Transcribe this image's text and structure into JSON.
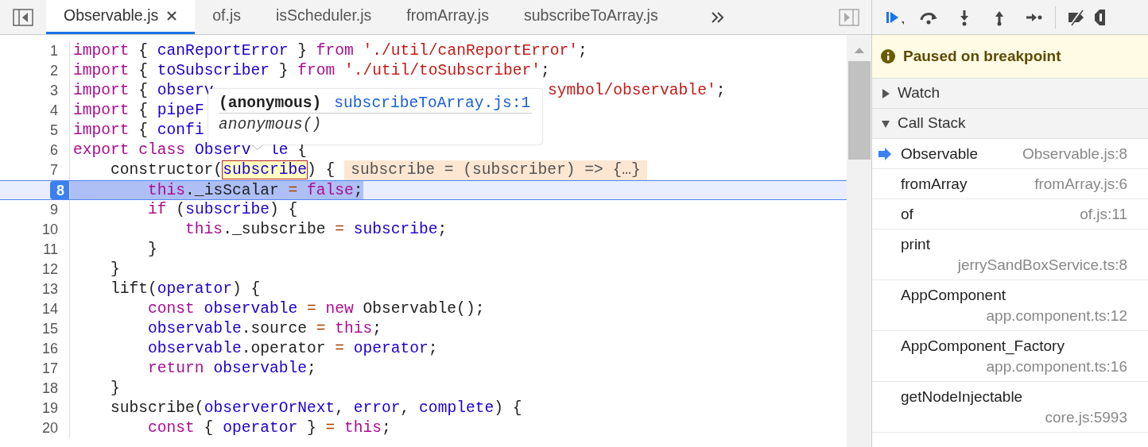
{
  "tabs": [
    {
      "label": "Observable.js",
      "selected": true,
      "closable": true
    },
    {
      "label": "of.js",
      "selected": false,
      "closable": false
    },
    {
      "label": "isScheduler.js",
      "selected": false,
      "closable": false
    },
    {
      "label": "fromArray.js",
      "selected": false,
      "closable": false
    },
    {
      "label": "subscribeToArray.js",
      "selected": false,
      "closable": false
    }
  ],
  "code": {
    "lines": [
      {
        "number": "1",
        "current": false,
        "tokens": [
          {
            "kind": "keyword",
            "text": "import"
          },
          {
            "kind": "plain",
            "text": " { "
          },
          {
            "kind": "variable",
            "text": "canReportError"
          },
          {
            "kind": "plain",
            "text": " } "
          },
          {
            "kind": "keyword",
            "text": "from"
          },
          {
            "kind": "string",
            "text": " './util/canReportError'"
          },
          {
            "kind": "plain",
            "text": ";"
          }
        ]
      },
      {
        "number": "2",
        "current": false,
        "tokens": [
          {
            "kind": "keyword",
            "text": "import"
          },
          {
            "kind": "plain",
            "text": " { "
          },
          {
            "kind": "variable",
            "text": "toSubscriber"
          },
          {
            "kind": "plain",
            "text": " } "
          },
          {
            "kind": "keyword",
            "text": "from"
          },
          {
            "kind": "string",
            "text": " './util/toSubscriber'"
          },
          {
            "kind": "plain",
            "text": ";"
          }
        ]
      },
      {
        "number": "3",
        "current": false,
        "tokens": [
          {
            "kind": "keyword",
            "text": "import"
          },
          {
            "kind": "plain",
            "text": " { "
          },
          {
            "kind": "variable",
            "text": "observ"
          }
        ],
        "tail": {
          "kind": "after_popover",
          "tokens": [
            {
              "kind": "string",
              "text": "symbol/observable'"
            },
            {
              "kind": "plain",
              "text": ";"
            }
          ]
        }
      },
      {
        "number": "4",
        "current": false,
        "tokens": [
          {
            "kind": "keyword",
            "text": "import"
          },
          {
            "kind": "plain",
            "text": " { "
          },
          {
            "kind": "variable",
            "text": "pipeF"
          }
        ]
      },
      {
        "number": "5",
        "current": false,
        "tokens": [
          {
            "kind": "keyword",
            "text": "import"
          },
          {
            "kind": "plain",
            "text": " { "
          },
          {
            "kind": "variable",
            "text": "confi"
          }
        ]
      },
      {
        "number": "6",
        "current": false,
        "tokens": [
          {
            "kind": "keyword",
            "text": "export"
          },
          {
            "kind": "keyword",
            "text": " class"
          },
          {
            "kind": "variable",
            "text": " Observ"
          }
        ],
        "tail": {
          "kind": "after_arrow",
          "tokens": [
            {
              "kind": "variable",
              "text": "le"
            },
            {
              "kind": "plain",
              "text": " {"
            }
          ]
        }
      },
      {
        "number": "7",
        "current": false,
        "tokens": [
          {
            "kind": "plain",
            "text": "    constructor("
          },
          {
            "kind": "hovered",
            "text": "subscribe"
          },
          {
            "kind": "plain",
            "text": ") {"
          }
        ],
        "inline_value": "subscribe = (subscriber) => {…}"
      },
      {
        "number": "8",
        "current": true,
        "tokens": [
          {
            "kind": "keyword",
            "text": "        this"
          },
          {
            "kind": "plain",
            "text": "._isScalar "
          },
          {
            "kind": "operator",
            "text": "="
          },
          {
            "kind": "keyword",
            "text": " false"
          },
          {
            "kind": "plain",
            "text": ";"
          }
        ]
      },
      {
        "number": "9",
        "current": false,
        "tokens": [
          {
            "kind": "keyword",
            "text": "        if"
          },
          {
            "kind": "plain",
            "text": " ("
          },
          {
            "kind": "variable",
            "text": "subscribe"
          },
          {
            "kind": "plain",
            "text": ") {"
          }
        ]
      },
      {
        "number": "10",
        "current": false,
        "tokens": [
          {
            "kind": "keyword",
            "text": "            this"
          },
          {
            "kind": "plain",
            "text": "._subscribe "
          },
          {
            "kind": "operator",
            "text": "="
          },
          {
            "kind": "variable",
            "text": " subscribe"
          },
          {
            "kind": "plain",
            "text": ";"
          }
        ]
      },
      {
        "number": "11",
        "current": false,
        "tokens": [
          {
            "kind": "plain",
            "text": "        }"
          }
        ]
      },
      {
        "number": "12",
        "current": false,
        "tokens": [
          {
            "kind": "plain",
            "text": "    }"
          }
        ]
      },
      {
        "number": "13",
        "current": false,
        "tokens": [
          {
            "kind": "plain",
            "text": "    lift("
          },
          {
            "kind": "variable",
            "text": "operator"
          },
          {
            "kind": "plain",
            "text": ") {"
          }
        ]
      },
      {
        "number": "14",
        "current": false,
        "tokens": [
          {
            "kind": "keyword",
            "text": "        const"
          },
          {
            "kind": "variable",
            "text": " observable"
          },
          {
            "kind": "operator",
            "text": " ="
          },
          {
            "kind": "keyword",
            "text": " new"
          },
          {
            "kind": "plain",
            "text": " Observable();"
          }
        ]
      },
      {
        "number": "15",
        "current": false,
        "tokens": [
          {
            "kind": "variable",
            "text": "        observable"
          },
          {
            "kind": "plain",
            "text": ".source "
          },
          {
            "kind": "operator",
            "text": "="
          },
          {
            "kind": "keyword",
            "text": " this"
          },
          {
            "kind": "plain",
            "text": ";"
          }
        ]
      },
      {
        "number": "16",
        "current": false,
        "tokens": [
          {
            "kind": "variable",
            "text": "        observable"
          },
          {
            "kind": "plain",
            "text": ".operator "
          },
          {
            "kind": "operator",
            "text": "="
          },
          {
            "kind": "variable",
            "text": " operator"
          },
          {
            "kind": "plain",
            "text": ";"
          }
        ]
      },
      {
        "number": "17",
        "current": false,
        "tokens": [
          {
            "kind": "keyword",
            "text": "        return"
          },
          {
            "kind": "variable",
            "text": " observable"
          },
          {
            "kind": "plain",
            "text": ";"
          }
        ]
      },
      {
        "number": "18",
        "current": false,
        "tokens": [
          {
            "kind": "plain",
            "text": "    }"
          }
        ]
      },
      {
        "number": "19",
        "current": false,
        "tokens": [
          {
            "kind": "plain",
            "text": "    subscribe("
          },
          {
            "kind": "variable",
            "text": "observerOrNext"
          },
          {
            "kind": "plain",
            "text": ", "
          },
          {
            "kind": "variable",
            "text": "error"
          },
          {
            "kind": "plain",
            "text": ", "
          },
          {
            "kind": "variable",
            "text": "complete"
          },
          {
            "kind": "plain",
            "text": ") {"
          }
        ]
      },
      {
        "number": "20",
        "current": false,
        "tokens": [
          {
            "kind": "keyword",
            "text": "        const"
          },
          {
            "kind": "plain",
            "text": " { "
          },
          {
            "kind": "variable",
            "text": "operator"
          },
          {
            "kind": "plain",
            "text": " } "
          },
          {
            "kind": "operator",
            "text": "="
          },
          {
            "kind": "keyword",
            "text": " this"
          },
          {
            "kind": "plain",
            "text": ";"
          }
        ]
      }
    ]
  },
  "tooltip": {
    "title": "(anonymous)",
    "link": "subscribeToArray.js:1",
    "body": "anonymous()"
  },
  "banner": {
    "text": "Paused on breakpoint"
  },
  "sections": [
    {
      "title": "Watch",
      "expanded": false
    },
    {
      "title": "Call Stack",
      "expanded": true
    }
  ],
  "call_stack": [
    {
      "name": "Observable",
      "location": "Observable.js:8",
      "selected": true,
      "wrapped": false
    },
    {
      "name": "fromArray",
      "location": "fromArray.js:6",
      "selected": false,
      "wrapped": false
    },
    {
      "name": "of",
      "location": "of.js:11",
      "selected": false,
      "wrapped": false
    },
    {
      "name": "print",
      "location": "jerrySandBoxService.ts:8",
      "selected": false,
      "wrapped": true
    },
    {
      "name": "AppComponent",
      "location": "app.component.ts:12",
      "selected": false,
      "wrapped": true
    },
    {
      "name": "AppComponent_Factory",
      "location": "app.component.ts:16",
      "selected": false,
      "wrapped": true
    },
    {
      "name": "getNodeInjectable",
      "location": "core.js:5993",
      "selected": false,
      "wrapped": true
    }
  ]
}
